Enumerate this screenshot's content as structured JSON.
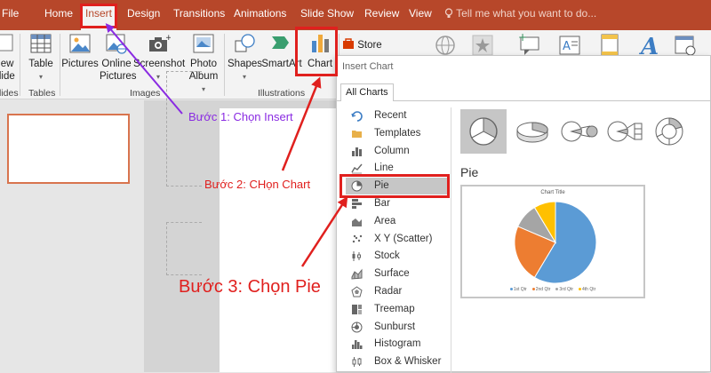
{
  "ribbon_tabs": {
    "file": "File",
    "home": "Home",
    "insert": "Insert",
    "design": "Design",
    "transitions": "Transitions",
    "animations": "Animations",
    "slide_show": "Slide Show",
    "review": "Review",
    "view": "View",
    "tell_me": "Tell me what you want to do..."
  },
  "ribbon": {
    "new_slide": {
      "line1": "New",
      "line2": "Slide"
    },
    "table": "Table",
    "pictures": "Pictures",
    "online_pictures": {
      "line1": "Online",
      "line2": "Pictures"
    },
    "screenshot": "Screenshot",
    "photo_album": {
      "line1": "Photo",
      "line2": "Album"
    },
    "shapes": "Shapes",
    "smartart": "SmartArt",
    "chart": "Chart",
    "store": "Store",
    "groups": {
      "slides": "Slides",
      "tables": "Tables",
      "images": "Images",
      "illustrations": "Illustrations"
    }
  },
  "dialog": {
    "title": "Insert Chart",
    "tab": "All Charts",
    "chart_types": [
      {
        "label": "Recent",
        "icon": "recent-icon"
      },
      {
        "label": "Templates",
        "icon": "folder-icon"
      },
      {
        "label": "Column",
        "icon": "column-chart-icon"
      },
      {
        "label": "Line",
        "icon": "line-chart-icon"
      },
      {
        "label": "Pie",
        "icon": "pie-chart-icon",
        "selected": true
      },
      {
        "label": "Bar",
        "icon": "bar-chart-icon"
      },
      {
        "label": "Area",
        "icon": "area-chart-icon"
      },
      {
        "label": "X Y (Scatter)",
        "icon": "scatter-chart-icon"
      },
      {
        "label": "Stock",
        "icon": "stock-chart-icon"
      },
      {
        "label": "Surface",
        "icon": "surface-chart-icon"
      },
      {
        "label": "Radar",
        "icon": "radar-chart-icon"
      },
      {
        "label": "Treemap",
        "icon": "treemap-chart-icon"
      },
      {
        "label": "Sunburst",
        "icon": "sunburst-chart-icon"
      },
      {
        "label": "Histogram",
        "icon": "histogram-chart-icon"
      },
      {
        "label": "Box & Whisker",
        "icon": "box-whisker-chart-icon"
      }
    ],
    "subtypes": [
      "pie",
      "3-d-pie",
      "pie-of-pie",
      "bar-of-pie",
      "doughnut"
    ],
    "selected_type_name": "Pie",
    "preview": {
      "title": "Chart Title",
      "legend": [
        "1st Qtr",
        "2nd Qtr",
        "3rd Qtr",
        "4th Qtr"
      ],
      "slices": [
        {
          "label": "1st Qtr",
          "value": 8.2,
          "color": "#5b9bd5"
        },
        {
          "label": "2nd Qtr",
          "value": 3.2,
          "color": "#ed7d31"
        },
        {
          "label": "3rd Qtr",
          "value": 1.4,
          "color": "#a5a5a5"
        },
        {
          "label": "4th Qtr",
          "value": 1.2,
          "color": "#ffc000"
        }
      ]
    }
  },
  "annotations": {
    "step1": "Bước 1: Chọn Insert",
    "step2": "Bước 2: CHọn Chart",
    "step3": "Bước 3: Chọn Pie",
    "step1_color": "#8a2be2",
    "step2_color": "#e0201e"
  },
  "colors": {
    "ribbon_accent": "#b7472a",
    "highlight_red": "#e0201e",
    "arrow_purple": "#8a2be2"
  }
}
